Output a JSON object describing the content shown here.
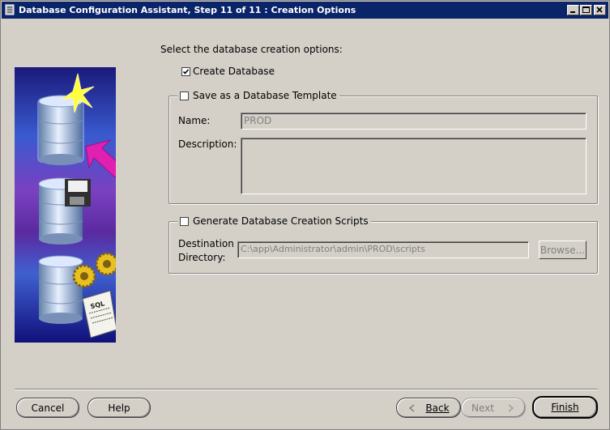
{
  "window": {
    "title": "Database Configuration Assistant, Step 11 of 11 : Creation Options"
  },
  "main": {
    "prompt": "Select the database creation options:",
    "create_database": {
      "label": "Create Database",
      "checked": true
    },
    "save_template": {
      "label": "Save as a Database Template",
      "checked": false,
      "name_label": "Name:",
      "name_value": "PROD",
      "description_label": "Description:",
      "description_value": ""
    },
    "generate_scripts": {
      "label": "Generate Database Creation Scripts",
      "checked": false,
      "destination_label_line1": "Destination",
      "destination_label_line2": "Directory:",
      "destination_value": "C:\\app\\Administrator\\admin\\PROD\\scripts",
      "browse_label": "Browse..."
    }
  },
  "illustration": {
    "icons": [
      "database-star-icon",
      "database-floppy-icon",
      "database-sql-gears-icon"
    ],
    "colors": {
      "top": "#1a1a7a",
      "middle": "#5a2aa0",
      "bottom": "#10107a",
      "arrow": "#e020b0"
    },
    "sql_text": "SQL"
  },
  "footer": {
    "cancel_label": "Cancel",
    "help_label": "Help",
    "back_label": "Back",
    "next_label": "Next",
    "finish_label": "Finish"
  },
  "colors": {
    "titlebar": "#0a246a",
    "face": "#d4d0c8"
  }
}
